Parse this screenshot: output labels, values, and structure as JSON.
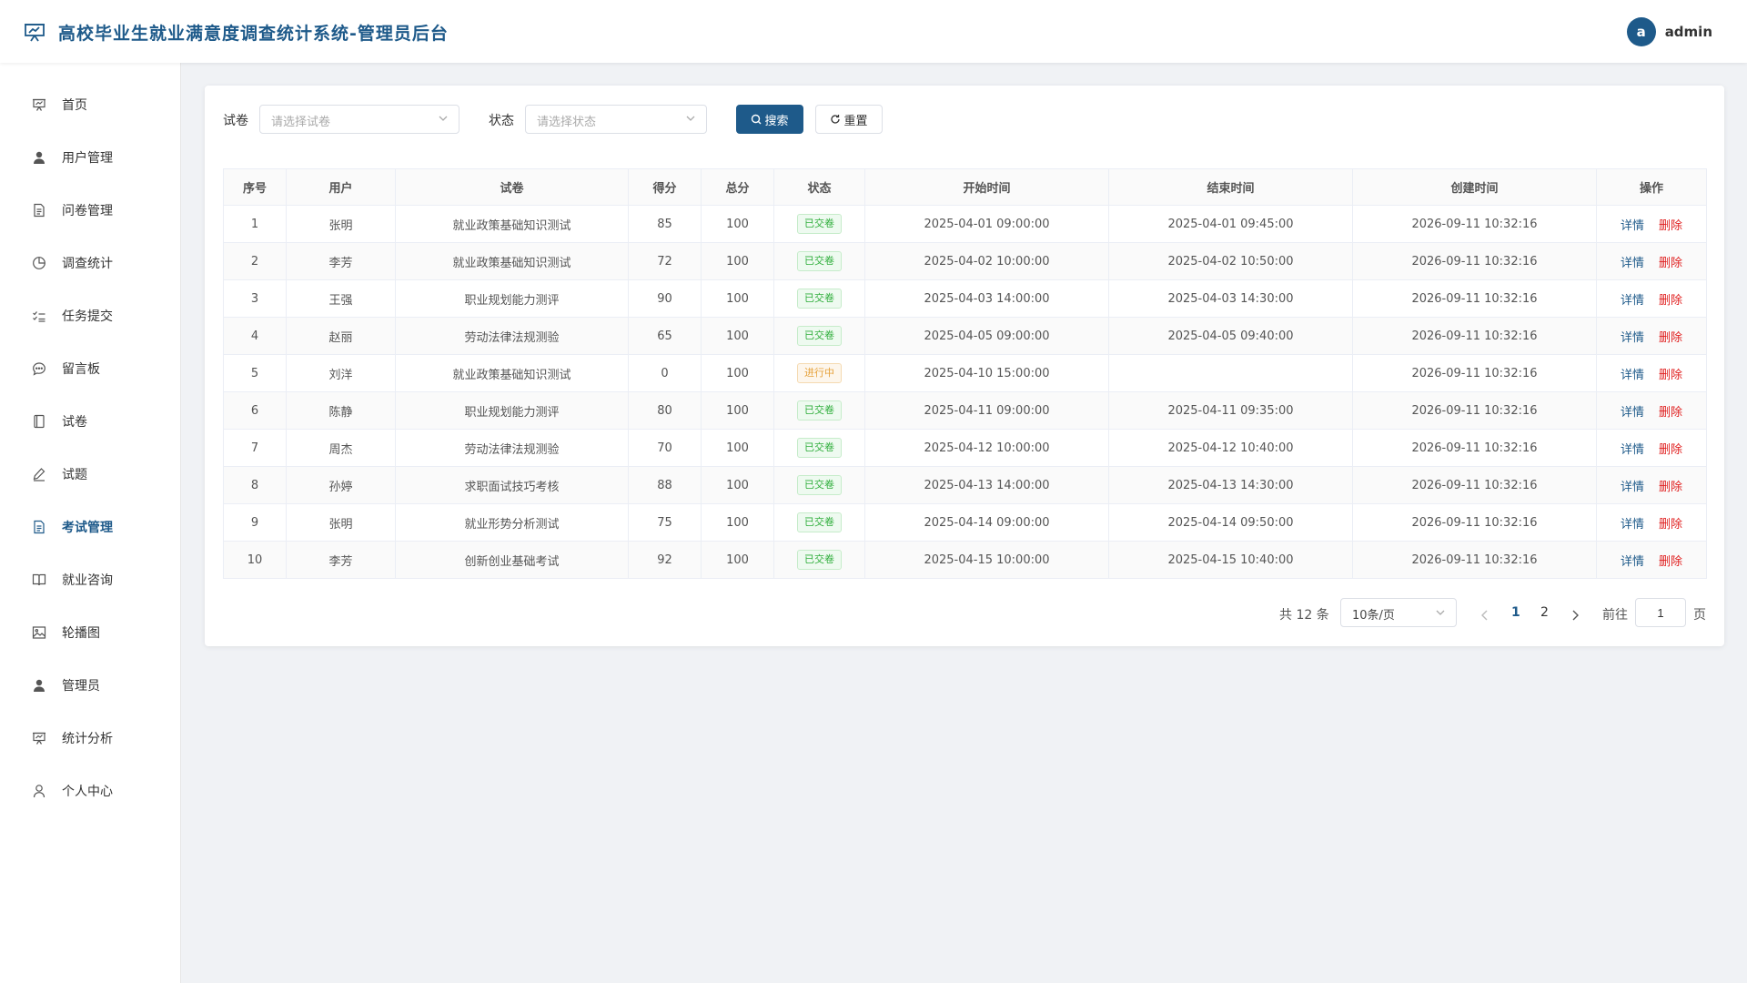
{
  "header": {
    "title": "高校毕业生就业满意度调查统计系统-管理员后台",
    "avatar_letter": "a",
    "username": "admin"
  },
  "sidebar": {
    "items": [
      {
        "label": "首页",
        "icon": "presentation-icon"
      },
      {
        "label": "用户管理",
        "icon": "user-icon"
      },
      {
        "label": "问卷管理",
        "icon": "document-icon"
      },
      {
        "label": "调查统计",
        "icon": "pie-chart-icon"
      },
      {
        "label": "任务提交",
        "icon": "checklist-icon"
      },
      {
        "label": "留言板",
        "icon": "chat-icon"
      },
      {
        "label": "试卷",
        "icon": "notebook-icon"
      },
      {
        "label": "试题",
        "icon": "edit-icon"
      },
      {
        "label": "考试管理",
        "icon": "document-icon"
      },
      {
        "label": "就业咨询",
        "icon": "book-icon"
      },
      {
        "label": "轮播图",
        "icon": "picture-icon"
      },
      {
        "label": "管理员",
        "icon": "user-icon"
      },
      {
        "label": "统计分析",
        "icon": "presentation-icon"
      },
      {
        "label": "个人中心",
        "icon": "user-outline-icon"
      }
    ],
    "active_index": 8
  },
  "filters": {
    "paper_label": "试卷",
    "paper_placeholder": "请选择试卷",
    "status_label": "状态",
    "status_placeholder": "请选择状态",
    "search_label": "搜索",
    "reset_label": "重置"
  },
  "table": {
    "columns": [
      "序号",
      "用户",
      "试卷",
      "得分",
      "总分",
      "状态",
      "开始时间",
      "结束时间",
      "创建时间",
      "操作"
    ],
    "detail_label": "详情",
    "delete_label": "删除",
    "rows": [
      {
        "no": "1",
        "user": "张明",
        "paper": "就业政策基础知识测试",
        "score": "85",
        "total": "100",
        "status": "已交卷",
        "status_type": "success",
        "start": "2025-04-01 09:00:00",
        "end": "2025-04-01 09:45:00",
        "created": "2026-09-11 10:32:16"
      },
      {
        "no": "2",
        "user": "李芳",
        "paper": "就业政策基础知识测试",
        "score": "72",
        "total": "100",
        "status": "已交卷",
        "status_type": "success",
        "start": "2025-04-02 10:00:00",
        "end": "2025-04-02 10:50:00",
        "created": "2026-09-11 10:32:16"
      },
      {
        "no": "3",
        "user": "王强",
        "paper": "职业规划能力测评",
        "score": "90",
        "total": "100",
        "status": "已交卷",
        "status_type": "success",
        "start": "2025-04-03 14:00:00",
        "end": "2025-04-03 14:30:00",
        "created": "2026-09-11 10:32:16"
      },
      {
        "no": "4",
        "user": "赵丽",
        "paper": "劳动法律法规测验",
        "score": "65",
        "total": "100",
        "status": "已交卷",
        "status_type": "success",
        "start": "2025-04-05 09:00:00",
        "end": "2025-04-05 09:40:00",
        "created": "2026-09-11 10:32:16"
      },
      {
        "no": "5",
        "user": "刘洋",
        "paper": "就业政策基础知识测试",
        "score": "0",
        "total": "100",
        "status": "进行中",
        "status_type": "warning",
        "start": "2025-04-10 15:00:00",
        "end": "",
        "created": "2026-09-11 10:32:16"
      },
      {
        "no": "6",
        "user": "陈静",
        "paper": "职业规划能力测评",
        "score": "80",
        "total": "100",
        "status": "已交卷",
        "status_type": "success",
        "start": "2025-04-11 09:00:00",
        "end": "2025-04-11 09:35:00",
        "created": "2026-09-11 10:32:16"
      },
      {
        "no": "7",
        "user": "周杰",
        "paper": "劳动法律法规测验",
        "score": "70",
        "total": "100",
        "status": "已交卷",
        "status_type": "success",
        "start": "2025-04-12 10:00:00",
        "end": "2025-04-12 10:40:00",
        "created": "2026-09-11 10:32:16"
      },
      {
        "no": "8",
        "user": "孙婷",
        "paper": "求职面试技巧考核",
        "score": "88",
        "total": "100",
        "status": "已交卷",
        "status_type": "success",
        "start": "2025-04-13 14:00:00",
        "end": "2025-04-13 14:30:00",
        "created": "2026-09-11 10:32:16"
      },
      {
        "no": "9",
        "user": "张明",
        "paper": "就业形势分析测试",
        "score": "75",
        "total": "100",
        "status": "已交卷",
        "status_type": "success",
        "start": "2025-04-14 09:00:00",
        "end": "2025-04-14 09:50:00",
        "created": "2026-09-11 10:32:16"
      },
      {
        "no": "10",
        "user": "李芳",
        "paper": "创新创业基础考试",
        "score": "92",
        "total": "100",
        "status": "已交卷",
        "status_type": "success",
        "start": "2025-04-15 10:00:00",
        "end": "2025-04-15 10:40:00",
        "created": "2026-09-11 10:32:16"
      }
    ]
  },
  "pagination": {
    "total_text": "共 12 条",
    "page_size": "10条/页",
    "pages": [
      "1",
      "2"
    ],
    "current_page": "1",
    "goto_label": "前往",
    "goto_value": "1",
    "page_suffix": "页"
  },
  "colors": {
    "primary": "#1e5a8a",
    "success": "#2fae3b",
    "warning": "#e6a23c",
    "danger": "#e02020"
  }
}
